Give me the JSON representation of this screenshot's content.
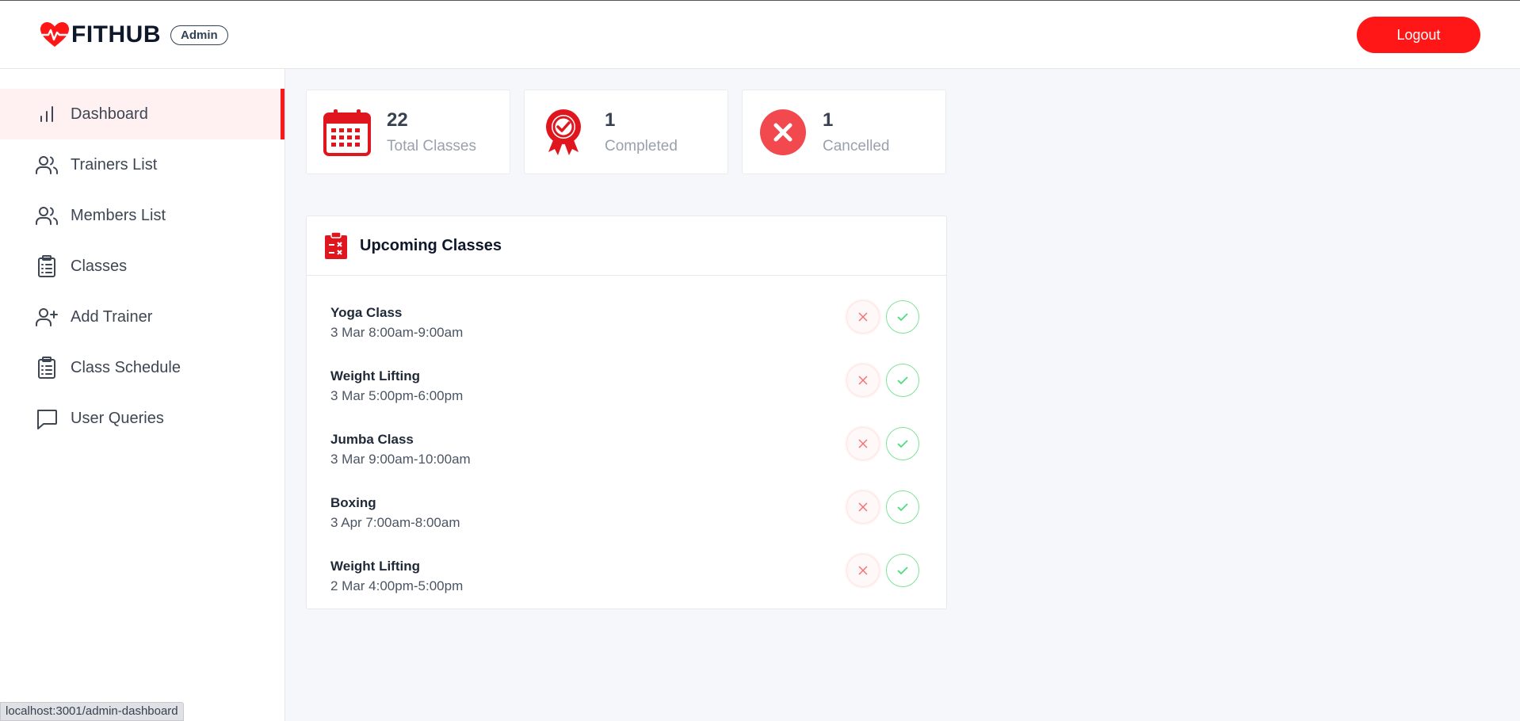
{
  "header": {
    "brand": "FITHUB",
    "role_badge": "Admin",
    "logout_label": "Logout"
  },
  "sidebar": {
    "items": [
      {
        "label": "Dashboard",
        "icon": "bar-chart-icon",
        "active": true
      },
      {
        "label": "Trainers List",
        "icon": "users-icon"
      },
      {
        "label": "Members List",
        "icon": "users-icon"
      },
      {
        "label": "Classes",
        "icon": "clipboard-list-icon"
      },
      {
        "label": "Add Trainer",
        "icon": "user-plus-icon"
      },
      {
        "label": "Class Schedule",
        "icon": "clipboard-list-icon"
      },
      {
        "label": "User Queries",
        "icon": "message-square-icon"
      }
    ]
  },
  "stats": [
    {
      "value": "22",
      "label": "Total Classes",
      "icon": "calendar-icon"
    },
    {
      "value": "1",
      "label": "Completed",
      "icon": "award-badge-icon"
    },
    {
      "value": "1",
      "label": "Cancelled",
      "icon": "x-circle-icon"
    }
  ],
  "upcoming": {
    "title": "Upcoming Classes",
    "classes": [
      {
        "name": "Yoga Class",
        "time": "3 Mar 8:00am-9:00am"
      },
      {
        "name": "Weight Lifting",
        "time": "3 Mar 5:00pm-6:00pm"
      },
      {
        "name": "Jumba Class",
        "time": "3 Mar 9:00am-10:00am"
      },
      {
        "name": "Boxing",
        "time": "3 Apr 7:00am-8:00am"
      },
      {
        "name": "Weight Lifting",
        "time": "2 Mar 4:00pm-5:00pm"
      }
    ]
  },
  "status_bar": {
    "url": "localhost:3001/admin-dashboard"
  },
  "colors": {
    "accent": "#ff1616",
    "success": "#4ade80",
    "active_bg": "#fff1f1"
  }
}
